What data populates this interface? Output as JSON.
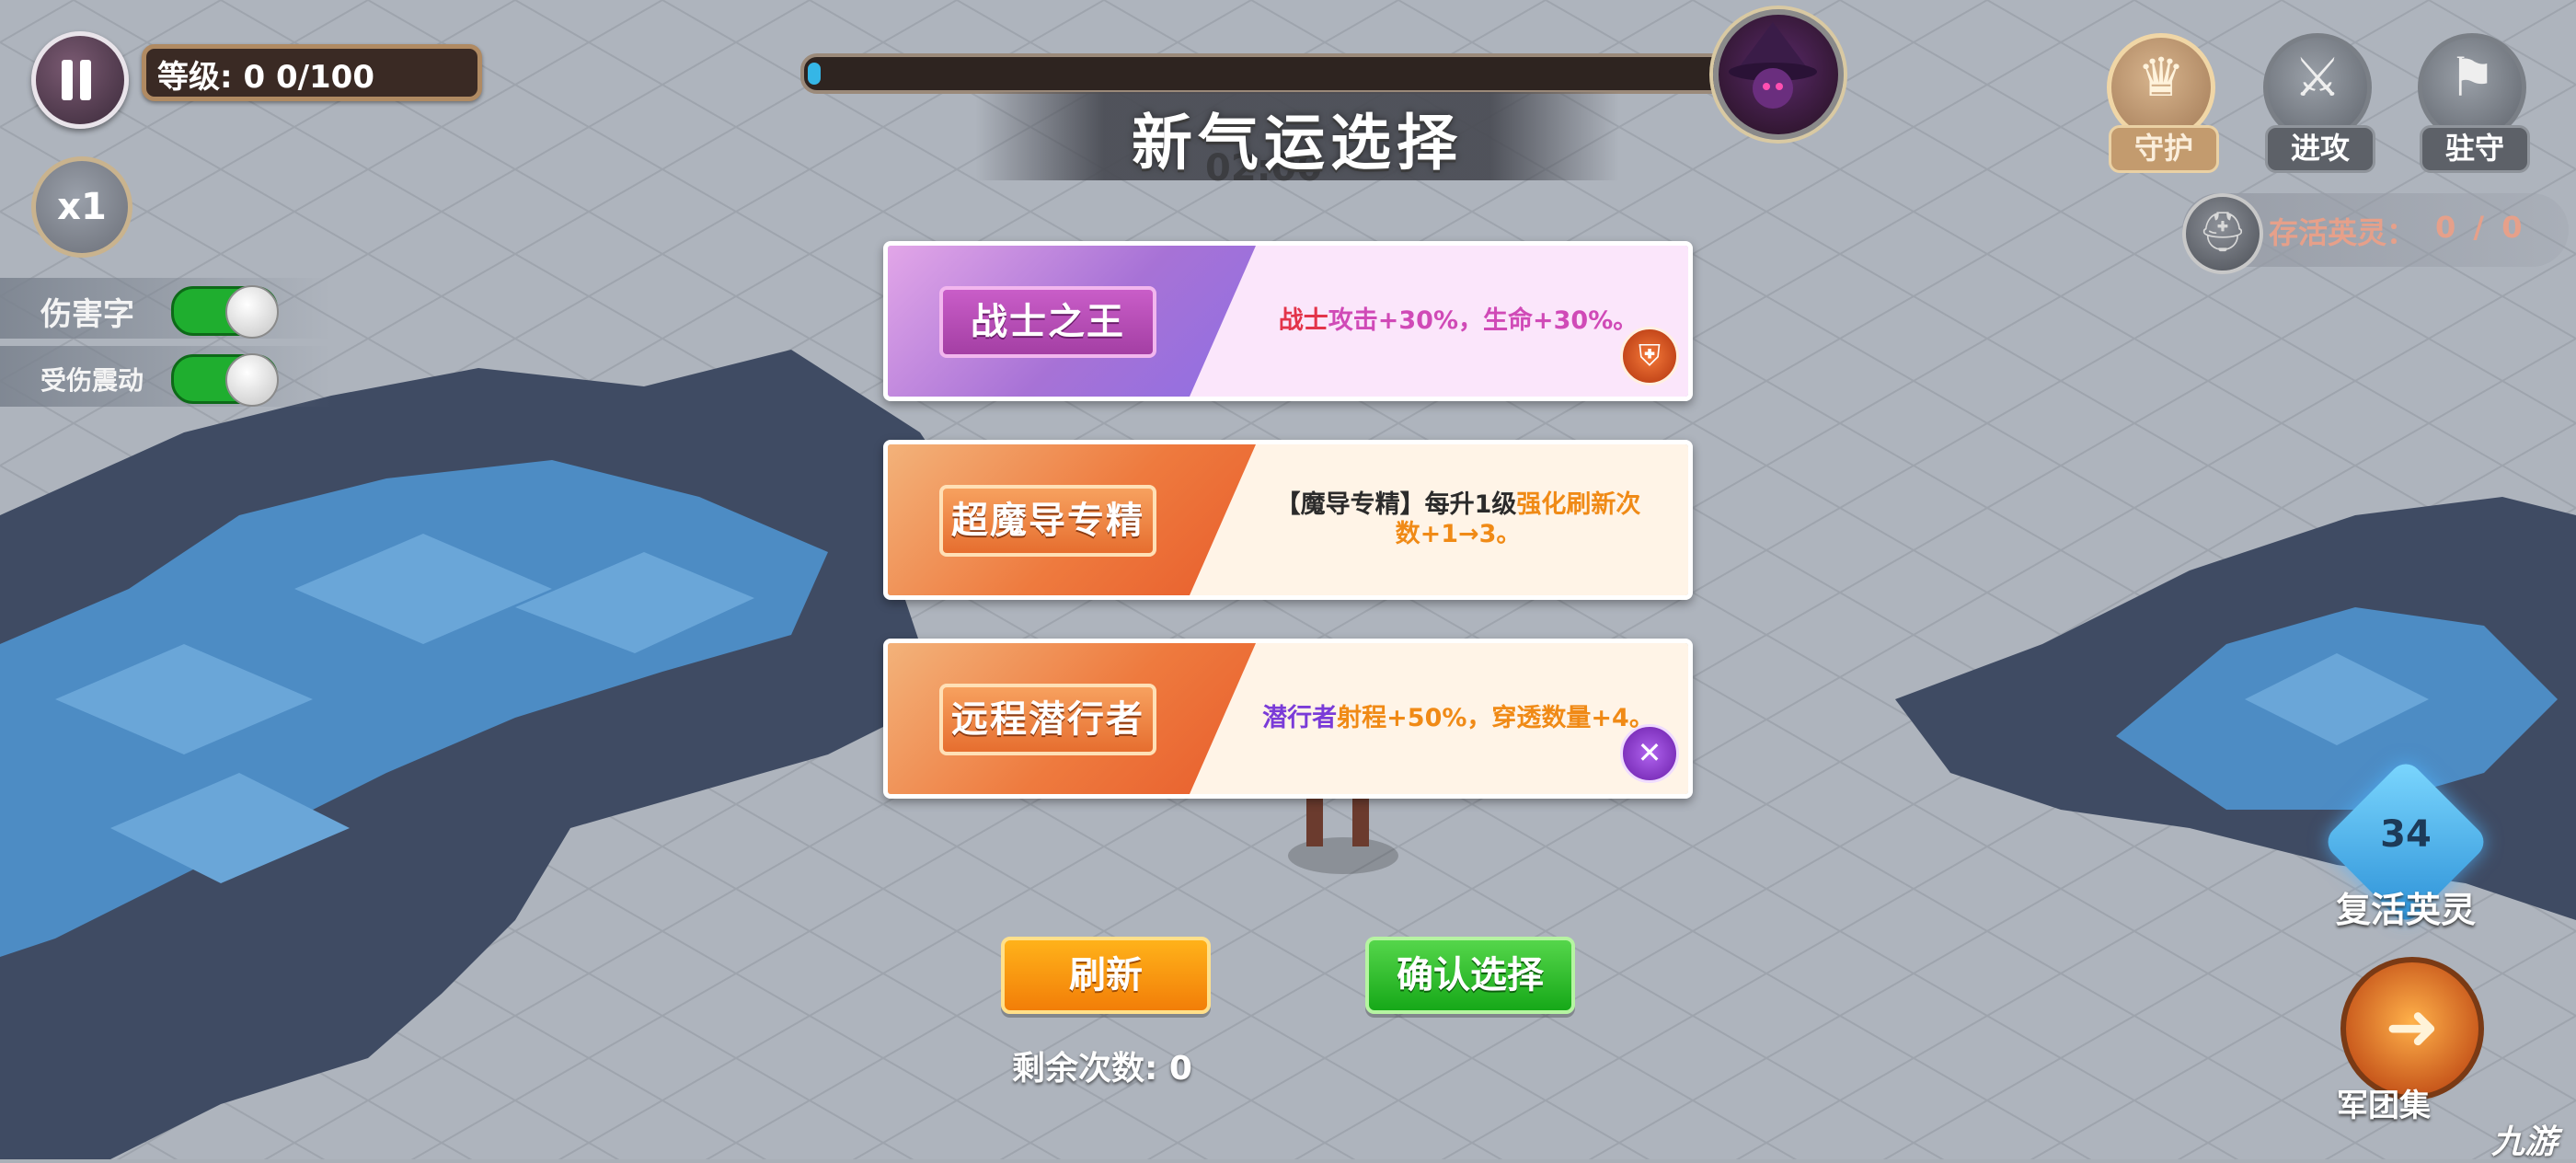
{
  "hud": {
    "level_label": "等级",
    "level_value": "0",
    "level_progress": "0/100",
    "speed_label": "x1",
    "damage_text_toggle": {
      "label": "伤害字",
      "on": true
    },
    "hit_shake_toggle": {
      "label": "受伤震动",
      "on": true
    },
    "wave_progress_fraction": 0.01,
    "timer": "02:00"
  },
  "title": "新气运选择",
  "modes": [
    {
      "label": "守护",
      "icon": "crown-icon",
      "active": true
    },
    {
      "label": "进攻",
      "icon": "crossed-swords-icon",
      "active": false
    },
    {
      "label": "驻守",
      "icon": "banner-icon",
      "active": false
    }
  ],
  "survive": {
    "label": "存活英灵：",
    "count": "0 / 0"
  },
  "cards": [
    {
      "name": "战士之王",
      "desc_parts": [
        {
          "text": "战士",
          "color": "red"
        },
        {
          "text": "攻击+30%，",
          "color": "pink"
        },
        {
          "text": "生命+30%。",
          "color": "pink"
        }
      ],
      "tag_icon": "shield-icon"
    },
    {
      "name": "超魔导专精",
      "desc_parts": [
        {
          "text": "【魔导专精】每升1级",
          "color": "dark"
        },
        {
          "text": "强化刷新次数+1→3。",
          "color": "orange"
        }
      ],
      "tag_icon": ""
    },
    {
      "name": "远程潜行者",
      "desc_parts": [
        {
          "text": "潜行者",
          "color": "purple"
        },
        {
          "text": "射程+50%，",
          "color": "orange"
        },
        {
          "text": "穿透数量+4。",
          "color": "orange"
        }
      ],
      "tag_icon": "crossed-daggers-icon"
    }
  ],
  "buttons": {
    "refresh": "刷新",
    "confirm": "确认选择"
  },
  "remaining": "剩余次数: 0",
  "revive": {
    "count": "34",
    "label": "复活英灵"
  },
  "legion": {
    "label": "军团集"
  },
  "watermark": "九游"
}
